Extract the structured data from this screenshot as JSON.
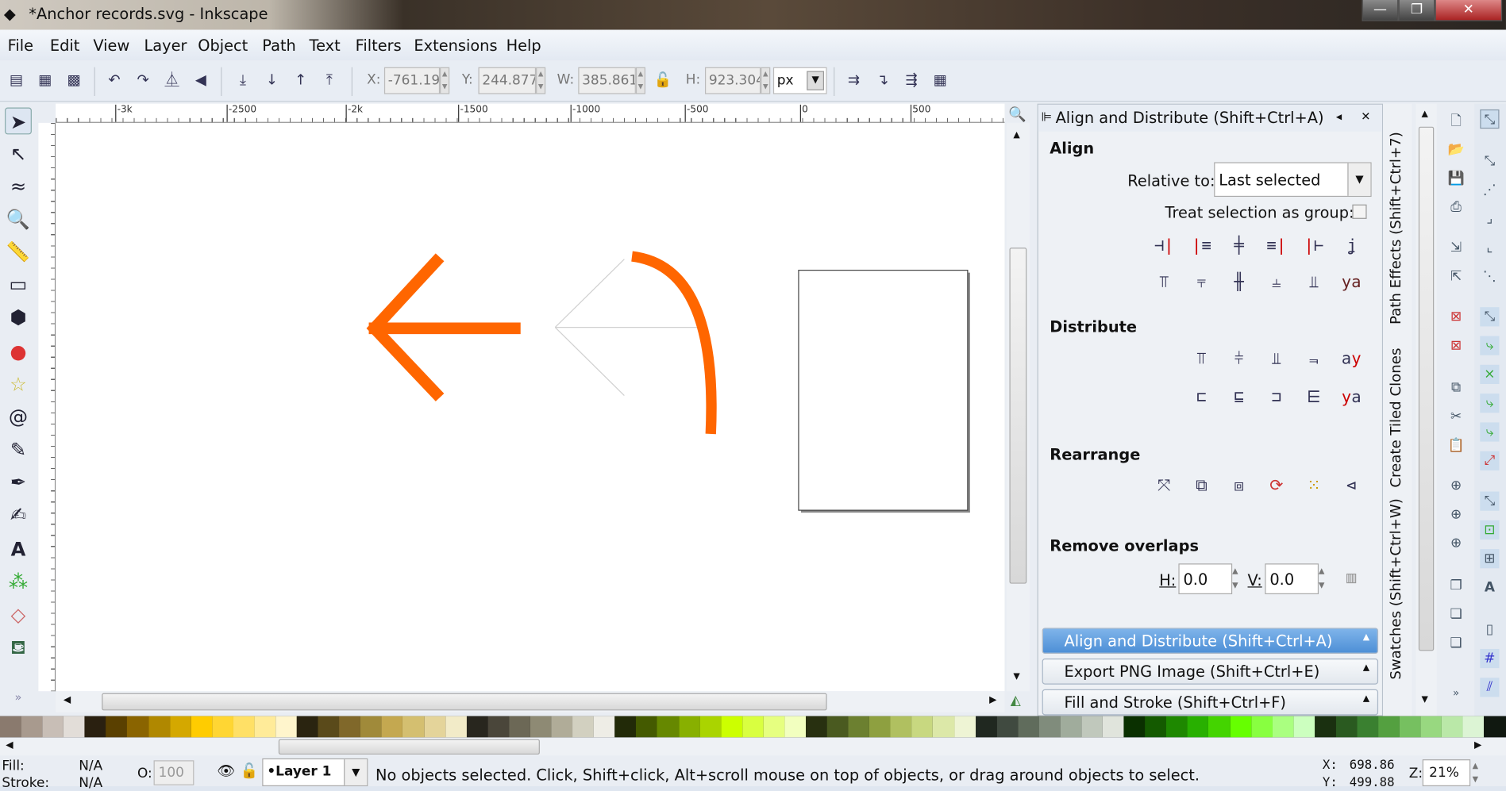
{
  "window": {
    "title": "*Anchor records.svg - Inkscape",
    "buttons": [
      "minimize",
      "maximize",
      "close"
    ]
  },
  "menu": [
    "File",
    "Edit",
    "View",
    "Layer",
    "Object",
    "Path",
    "Text",
    "Filters",
    "Extensions",
    "Help"
  ],
  "toolbar": {
    "x_label": "X:",
    "x_value": "-761.19",
    "y_label": "Y:",
    "y_value": "244.877",
    "w_label": "W:",
    "w_value": "385.861",
    "h_label": "H:",
    "h_value": "923.304",
    "unit": "px"
  },
  "ruler_ticks": [
    "-3k",
    "-2500",
    "-2k",
    "-1500",
    "-1000",
    "-500",
    "0",
    "500"
  ],
  "canvas": {
    "accent": "#ff6600"
  },
  "dock": {
    "title": "Align and Distribute (Shift+Ctrl+A)",
    "align": "Align",
    "relative_label": "Relative to:",
    "relative_value": "Last selected",
    "treat_group": "Treat selection as group:",
    "distribute": "Distribute",
    "rearrange": "Rearrange",
    "remove_overlaps": "Remove overlaps",
    "h_label": "H:",
    "h_value": "0.0",
    "v_label": "V:",
    "v_value": "0.0",
    "panels": [
      "Align and Distribute (Shift+Ctrl+A)",
      "Export PNG Image (Shift+Ctrl+E)",
      "Fill and Stroke (Shift+Ctrl+F)"
    ]
  },
  "vtabs": [
    "Path Effects (Shift+Ctrl+7)",
    "Create Tiled Clones",
    "Swatches (Shift+Ctrl+W)"
  ],
  "palette": [
    "#8a7a6e",
    "#a89a8e",
    "#c8beb6",
    "#e2ddd8",
    "#2a2010",
    "#5a4000",
    "#8a6400",
    "#b08800",
    "#d4a800",
    "#ffcc00",
    "#ffd633",
    "#ffe066",
    "#ffeb99",
    "#fff5cc",
    "#2a2410",
    "#5a4a1a",
    "#80682a",
    "#a08a3a",
    "#c4a850",
    "#d4bf70",
    "#e4d49a",
    "#f2ebc8",
    "#28261e",
    "#4a463a",
    "#6c6856",
    "#8e8a74",
    "#b0ac98",
    "#d2d0c0",
    "#eeede6",
    "#222a08",
    "#445a00",
    "#668800",
    "#88b000",
    "#aad400",
    "#ccff00",
    "#d9ff40",
    "#e6ff80",
    "#f2ffbf",
    "#283010",
    "#4a5a20",
    "#6c8030",
    "#8ea040",
    "#b0c060",
    "#c8d880",
    "#dce8a8",
    "#eef4d4",
    "#202820",
    "#404a40",
    "#606c5c",
    "#808c7c",
    "#a0ac9c",
    "#c0c8bc",
    "#e0e4dc",
    "#0a3000",
    "#145a00",
    "#1e8800",
    "#28b000",
    "#44d400",
    "#66ff00",
    "#88ff40",
    "#aaff80",
    "#ccffbf",
    "#1a3010",
    "#2a5a20",
    "#3a8030",
    "#54a040",
    "#76c060",
    "#98d880",
    "#bae8a8",
    "#dcf4d4",
    "#101810"
  ],
  "status": {
    "fill_label": "Fill:",
    "fill_value": "N/A",
    "stroke_label": "Stroke:",
    "stroke_value": "N/A",
    "opacity_label": "O:",
    "opacity_value": "100",
    "layer": "•Layer 1",
    "message": "No objects selected. Click, Shift+click, Alt+scroll mouse on top of objects, or drag around objects to select.",
    "x_label": "X:",
    "x_value": "698.86",
    "y_label": "Y:",
    "y_value": "499.88",
    "zoom_label": "Z:",
    "zoom_value": "21%"
  }
}
